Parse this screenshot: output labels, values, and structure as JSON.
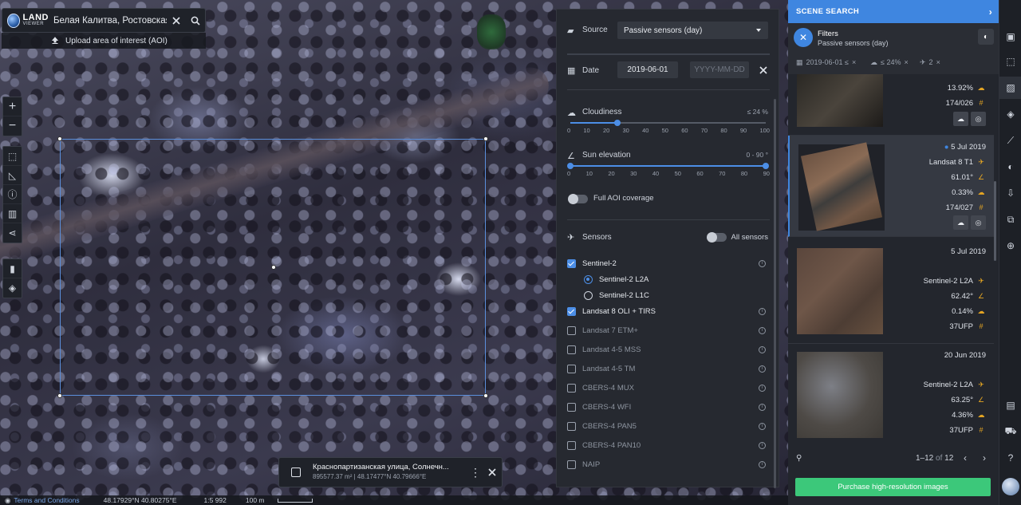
{
  "search": {
    "logo_line1": "LAND",
    "logo_line2": "VIEWER",
    "query": "Белая Калитва, Ростовская...",
    "upload_label": "Upload area of interest (AOI)"
  },
  "map_tools": {
    "zoom_in": "+",
    "zoom_out": "−"
  },
  "aoi_popup": {
    "address": "Краснопартизанская улица, Солнечн...",
    "details": "895577.37 m² | 48.17477°N 40.79666°E"
  },
  "statusbar": {
    "terms": "Terms and Conditions",
    "coords": "48.17929°N 40.80275°E",
    "scale": "1:5 992",
    "distance": "100 m"
  },
  "filters": {
    "source_label": "Source",
    "source_value": "Passive sensors (day)",
    "date_label": "Date",
    "date_from": "2019-06-01",
    "date_to_placeholder": "YYYY-MM-DD",
    "cloudiness_label": "Cloudiness",
    "cloudiness_value": "≤ 24 %",
    "cloudiness_level_percent": 24,
    "cloudiness_ticks": [
      "0",
      "10",
      "20",
      "30",
      "40",
      "50",
      "60",
      "70",
      "80",
      "90",
      "100"
    ],
    "sun_label": "Sun elevation",
    "sun_value": "0 - 90 °",
    "sun_range": [
      0,
      90
    ],
    "sun_ticks": [
      "0",
      "10",
      "20",
      "30",
      "40",
      "50",
      "60",
      "70",
      "80",
      "90"
    ],
    "aoi_coverage_label": "Full AOI coverage",
    "sensors_label": "Sensors",
    "all_sensors_label": "All sensors",
    "sensors": [
      {
        "label": "Sentinel-2",
        "checked": true
      },
      {
        "label": "Sentinel-2 L2A",
        "radio": true,
        "selected": true
      },
      {
        "label": "Sentinel-2 L1C",
        "radio": true,
        "selected": false
      },
      {
        "label": "Landsat 8 OLI + TIRS",
        "checked": true
      },
      {
        "label": "Landsat 7 ETM+",
        "checked": false
      },
      {
        "label": "Landsat 4-5 MSS",
        "checked": false
      },
      {
        "label": "Landsat 4-5 TM",
        "checked": false
      },
      {
        "label": "CBERS-4 MUX",
        "checked": false
      },
      {
        "label": "CBERS-4 WFI",
        "checked": false
      },
      {
        "label": "CBERS-4 PAN5",
        "checked": false
      },
      {
        "label": "CBERS-4 PAN10",
        "checked": false
      },
      {
        "label": "NAIP",
        "checked": false
      }
    ]
  },
  "scene_search": {
    "title": "SCENE SEARCH",
    "filters_title": "Filters",
    "filters_subtitle": "Passive sensors (day)",
    "chips": [
      "2019-06-01 ≤",
      "≤ 24%",
      "2"
    ],
    "results": [
      {
        "date": "",
        "sensor": "",
        "angle": "",
        "cloud": "13.92%",
        "tile": "174/026",
        "actions": true
      },
      {
        "date": "5 Jul 2019",
        "sensor": "Landsat  8  T1",
        "angle": "61.01°",
        "cloud": "0.33%",
        "tile": "174/027",
        "actions": true
      },
      {
        "date": "5 Jul 2019",
        "sensor": "Sentinel-2  L2A",
        "angle": "62.42°",
        "cloud": "0.14%",
        "tile": "37UFP",
        "actions": false
      },
      {
        "date": "20 Jun 2019",
        "sensor": "Sentinel-2  L2A",
        "angle": "63.25°",
        "cloud": "4.36%",
        "tile": "37UFP",
        "actions": false
      }
    ],
    "pager_range": "1–12",
    "pager_of": "of",
    "pager_total": "12",
    "purchase_label": "Purchase high-resolution images"
  },
  "colors": {
    "accent": "#3f86e0",
    "purchase": "#3cc87a",
    "aoi_outline": "#5b8fdc"
  }
}
